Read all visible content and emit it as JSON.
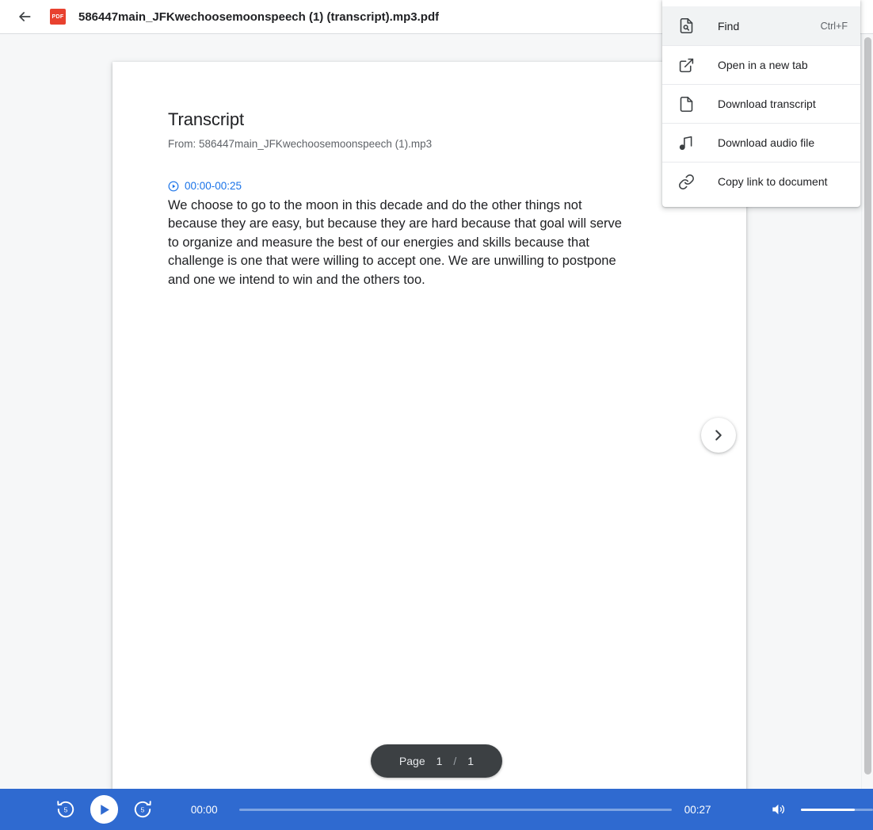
{
  "topbar": {
    "back_icon": "arrow-left-icon",
    "file_type_badge": "PDF",
    "title": "586447main_JFKwechoosemoonspeech (1) (transcript).mp3.pdf"
  },
  "menu": {
    "items": [
      {
        "icon": "find-document-icon",
        "label": "Find",
        "shortcut": "Ctrl+F",
        "active": true
      },
      {
        "icon": "open-in-new-tab-icon",
        "label": "Open in a new tab",
        "shortcut": "",
        "active": false
      },
      {
        "icon": "document-icon",
        "label": "Download transcript",
        "shortcut": "",
        "active": false
      },
      {
        "icon": "music-note-icon",
        "label": "Download audio file",
        "shortcut": "",
        "active": false
      },
      {
        "icon": "link-icon",
        "label": "Copy link to document",
        "shortcut": "",
        "active": false
      }
    ]
  },
  "document": {
    "heading": "Transcript",
    "source_line": "From: 586447main_JFKwechoosemoonspeech (1).mp3",
    "segments": [
      {
        "timestamp": "00:00-00:25",
        "timestamp_icon": "play-circle-icon",
        "text": "We choose to go to the moon in this decade and do the other things not because they are easy, but because they are hard because that goal will serve to organize and measure the best of our energies and skills because that challenge is one that were willing to accept one. We are unwilling to postpone and one we intend to win and the others too."
      }
    ]
  },
  "navigation": {
    "next_page_icon": "chevron-right-icon",
    "page_label": "Page",
    "current_page": "1",
    "page_separator": "/",
    "total_pages": "1"
  },
  "player": {
    "replay_icon": "replay-5-icon",
    "play_icon": "play-icon",
    "forward_icon": "forward-5-icon",
    "elapsed_time": "00:00",
    "total_time": "00:27",
    "progress_percent": 0,
    "volume_icon": "volume-up-icon",
    "volume_percent": 75,
    "accent_color": "#2f6ad0",
    "track_color": "#7ea4e3"
  }
}
